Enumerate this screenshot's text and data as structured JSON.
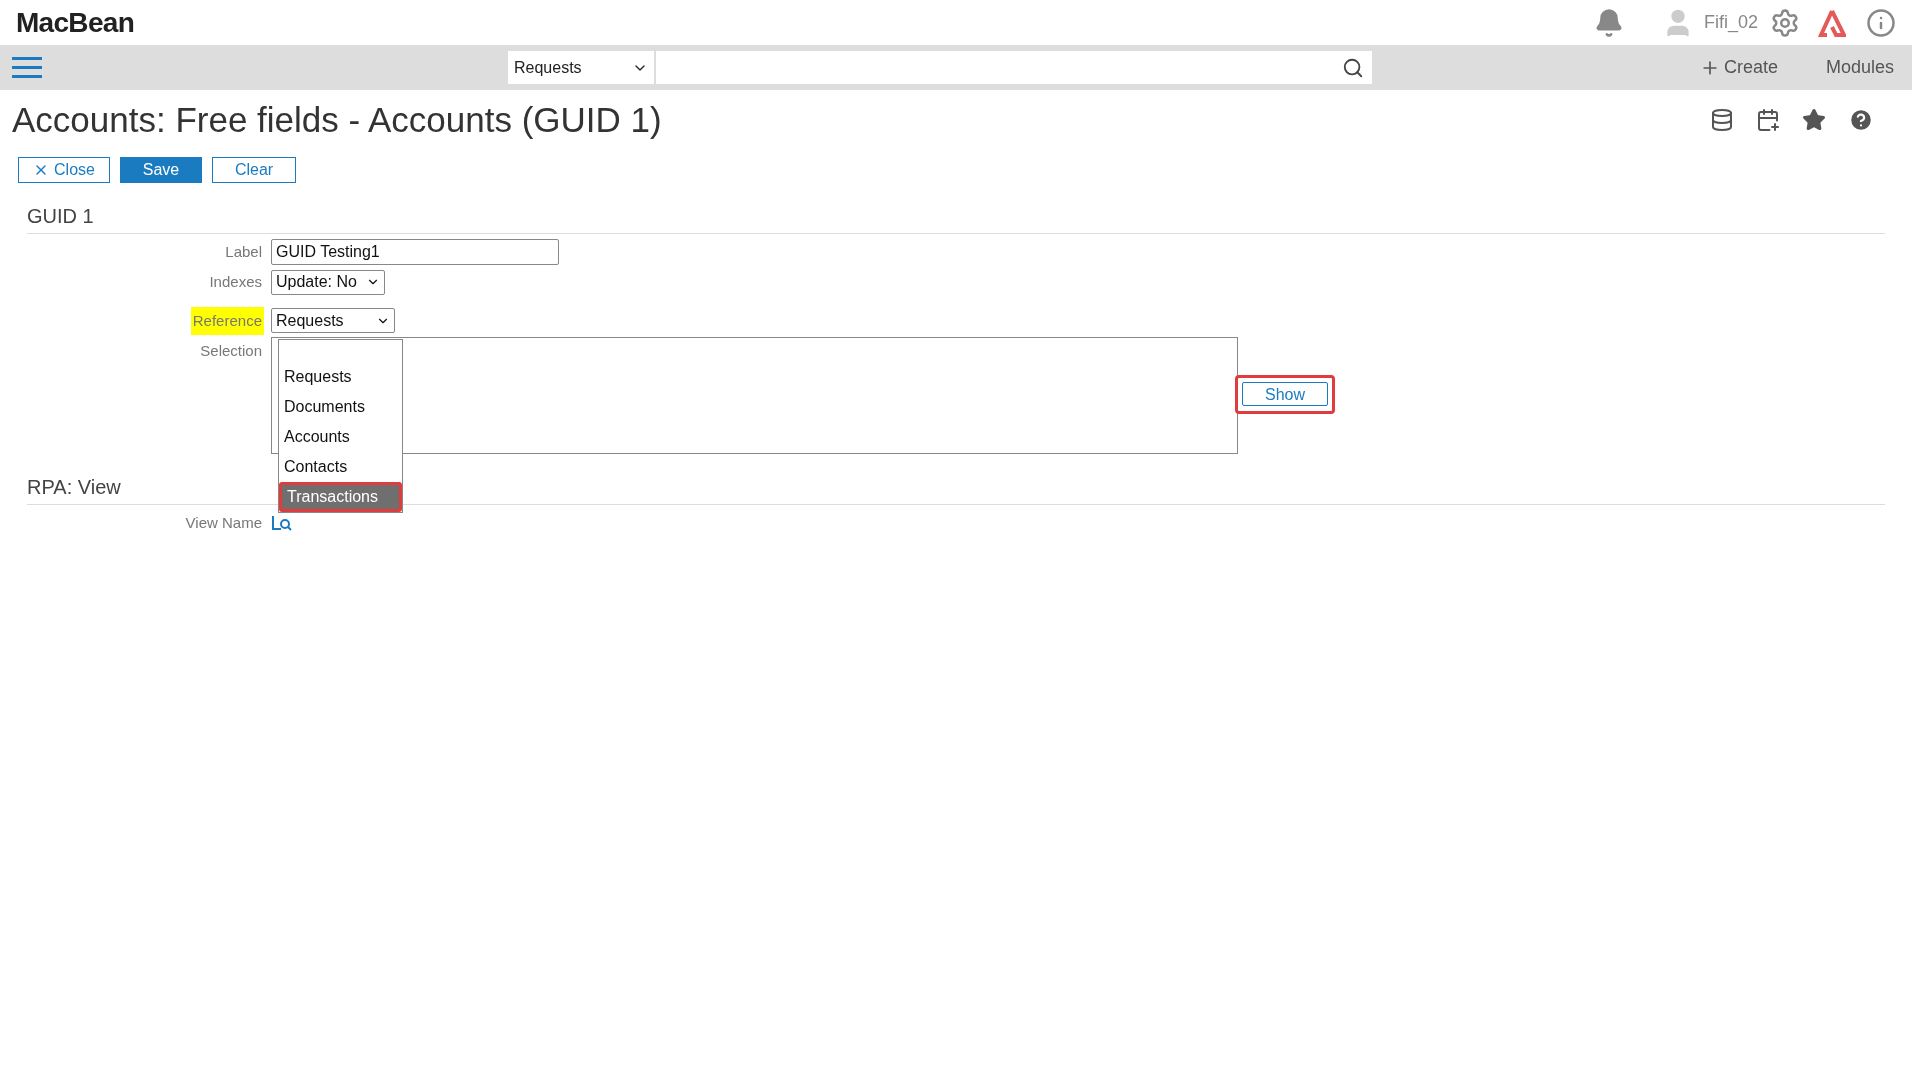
{
  "header": {
    "logo": "MacBean",
    "user": "Fifi_02"
  },
  "navbar": {
    "search_scope": "Requests",
    "create": "Create",
    "modules": "Modules"
  },
  "page": {
    "title": "Accounts: Free fields - Accounts (GUID 1)",
    "buttons": [
      {
        "label": "Close",
        "kind": "close"
      },
      {
        "label": "Save",
        "kind": "primary"
      },
      {
        "label": "Clear",
        "kind": "plain"
      }
    ]
  },
  "guid_section": {
    "title": "GUID 1",
    "label_field": {
      "label": "Label",
      "value": "GUID Testing1"
    },
    "indexes": {
      "label": "Indexes",
      "value": "Update: No"
    },
    "reference": {
      "label": "Reference",
      "value": "Requests",
      "highlighted": true
    },
    "selection": {
      "label": "Selection",
      "show_button": "Show",
      "show_annotated": true
    },
    "dropdown": {
      "options": [
        {
          "label": "Requests",
          "selected": false,
          "annotated": false
        },
        {
          "label": "Documents",
          "selected": false,
          "annotated": false
        },
        {
          "label": "Accounts",
          "selected": false,
          "annotated": false
        },
        {
          "label": "Contacts",
          "selected": false,
          "annotated": false
        },
        {
          "label": "Transactions",
          "selected": true,
          "annotated": true
        }
      ]
    }
  },
  "rpa_section": {
    "title": "RPA: View",
    "view_name": {
      "label": "View Name"
    }
  }
}
